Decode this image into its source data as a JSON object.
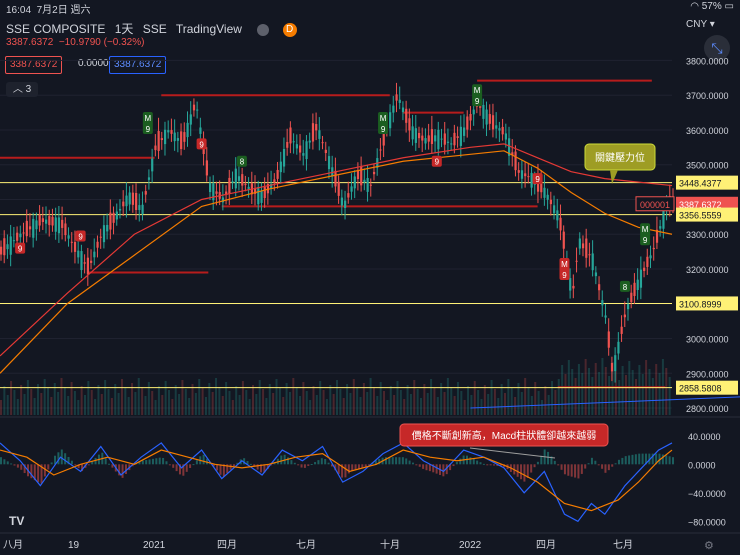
{
  "status": {
    "time": "16:04",
    "date": "7月2日 週六",
    "battery": "57%"
  },
  "header": {
    "symbol": "SSE COMPOSITE",
    "interval": "1天",
    "exchange": "SSE",
    "source": "TradingView",
    "badge": "D",
    "price": "3387.6372",
    "change": "−10.9790 (−0.32%)"
  },
  "indicators": {
    "box1": "3387.6372",
    "box2": "0.0000",
    "box3": "3387.6372",
    "collapse_count": "3"
  },
  "currency": "CNY",
  "colors": {
    "up": "#26a69a",
    "down": "#ef5350",
    "support": "#fff176",
    "resistance": "#b71c1c",
    "ma_short": "#e53935",
    "ma_long": "#f57c00",
    "macd": "#2962ff",
    "signal": "#f57c00"
  },
  "icons": {
    "expand": "expand-arrows-icon",
    "collapse": "chevron-up-icon",
    "logo": "tradingview-logo-icon",
    "settings": "gear-icon"
  },
  "chart_data": {
    "type": "candlestick",
    "price_axis": {
      "ylim": [
        2780,
        3830
      ],
      "ticks": [
        "3800.0000",
        "3700.0000",
        "3600.0000",
        "3500.0000",
        "3400.0000",
        "3300.0000",
        "3200.0000",
        "3100.0000",
        "3000.0000",
        "2900.0000",
        "2800.0000"
      ]
    },
    "macd_axis": {
      "ylim": [
        -95,
        65
      ],
      "ticks": [
        "40.0000",
        "0.0000",
        "−40.0000",
        "−80.0000"
      ]
    },
    "time_ticks": [
      {
        "label": "八月"
      },
      {
        "label": "19"
      },
      {
        "label": "2021"
      },
      {
        "label": "四月"
      },
      {
        "label": "七月"
      },
      {
        "label": "十月"
      },
      {
        "label": "2022"
      },
      {
        "label": "四月"
      },
      {
        "label": "七月"
      }
    ],
    "price_labels": [
      {
        "text": "3448.4377",
        "value": 3448.4377,
        "kind": "line"
      },
      {
        "text": "3387.6372",
        "value": 3387.6372,
        "kind": "last"
      },
      {
        "text": "3356.5559",
        "value": 3356.5559,
        "kind": "line"
      },
      {
        "text": "3100.8999",
        "value": 3100.8999,
        "kind": "line"
      },
      {
        "text": "2858.5808",
        "value": 2858.5808,
        "kind": "line"
      }
    ],
    "countdown": "000001",
    "support_lines": [
      3448.4377,
      3356.5559,
      3100.8999,
      2858.5808
    ],
    "resistance_segments": [
      {
        "from": 0,
        "to": 0.23,
        "price": 3520
      },
      {
        "from": 0.24,
        "to": 0.58,
        "price": 3700
      },
      {
        "from": 0.6,
        "to": 0.69,
        "price": 3650
      },
      {
        "from": 0.71,
        "to": 0.97,
        "price": 3742
      },
      {
        "from": 0.13,
        "to": 0.31,
        "price": 3190
      },
      {
        "from": 0.33,
        "to": 0.8,
        "price": 3380
      },
      {
        "from": 0.83,
        "to": 0.99,
        "price": 2860
      }
    ],
    "price_path": [
      [
        0,
        3250
      ],
      [
        0.03,
        3300
      ],
      [
        0.06,
        3340
      ],
      [
        0.09,
        3330
      ],
      [
        0.11,
        3260
      ],
      [
        0.13,
        3200
      ],
      [
        0.15,
        3300
      ],
      [
        0.17,
        3350
      ],
      [
        0.19,
        3410
      ],
      [
        0.21,
        3370
      ],
      [
        0.23,
        3550
      ],
      [
        0.25,
        3600
      ],
      [
        0.27,
        3560
      ],
      [
        0.29,
        3680
      ],
      [
        0.31,
        3440
      ],
      [
        0.33,
        3400
      ],
      [
        0.35,
        3470
      ],
      [
        0.37,
        3430
      ],
      [
        0.39,
        3410
      ],
      [
        0.41,
        3460
      ],
      [
        0.43,
        3580
      ],
      [
        0.45,
        3530
      ],
      [
        0.47,
        3610
      ],
      [
        0.49,
        3500
      ],
      [
        0.51,
        3380
      ],
      [
        0.53,
        3470
      ],
      [
        0.55,
        3440
      ],
      [
        0.57,
        3580
      ],
      [
        0.59,
        3700
      ],
      [
        0.61,
        3600
      ],
      [
        0.63,
        3570
      ],
      [
        0.65,
        3580
      ],
      [
        0.67,
        3560
      ],
      [
        0.69,
        3600
      ],
      [
        0.71,
        3680
      ],
      [
        0.73,
        3620
      ],
      [
        0.75,
        3590
      ],
      [
        0.77,
        3480
      ],
      [
        0.79,
        3460
      ],
      [
        0.81,
        3420
      ],
      [
        0.83,
        3350
      ],
      [
        0.84,
        3250
      ],
      [
        0.85,
        3120
      ],
      [
        0.86,
        3280
      ],
      [
        0.88,
        3230
      ],
      [
        0.9,
        3060
      ],
      [
        0.91,
        2900
      ],
      [
        0.93,
        3080
      ],
      [
        0.95,
        3170
      ],
      [
        0.97,
        3250
      ],
      [
        0.99,
        3380
      ],
      [
        1,
        3388
      ]
    ],
    "ma_short_path": [
      [
        0,
        2950
      ],
      [
        0.1,
        3130
      ],
      [
        0.2,
        3300
      ],
      [
        0.3,
        3400
      ],
      [
        0.4,
        3440
      ],
      [
        0.5,
        3480
      ],
      [
        0.6,
        3520
      ],
      [
        0.7,
        3550
      ],
      [
        0.75,
        3560
      ],
      [
        0.8,
        3520
      ],
      [
        0.85,
        3480
      ],
      [
        0.9,
        3460
      ],
      [
        1,
        3440
      ]
    ],
    "ma_long_path": [
      [
        0,
        2900
      ],
      [
        0.1,
        3100
      ],
      [
        0.2,
        3240
      ],
      [
        0.3,
        3380
      ],
      [
        0.4,
        3430
      ],
      [
        0.5,
        3470
      ],
      [
        0.6,
        3510
      ],
      [
        0.7,
        3530
      ],
      [
        0.75,
        3540
      ],
      [
        0.8,
        3490
      ],
      [
        0.85,
        3420
      ],
      [
        0.9,
        3360
      ],
      [
        0.95,
        3320
      ],
      [
        1,
        3300
      ]
    ],
    "macd_path": [
      [
        0,
        30
      ],
      [
        0.03,
        5
      ],
      [
        0.06,
        -30
      ],
      [
        0.09,
        10
      ],
      [
        0.12,
        -10
      ],
      [
        0.15,
        25
      ],
      [
        0.18,
        -15
      ],
      [
        0.21,
        10
      ],
      [
        0.24,
        30
      ],
      [
        0.27,
        -5
      ],
      [
        0.3,
        20
      ],
      [
        0.33,
        -20
      ],
      [
        0.36,
        5
      ],
      [
        0.39,
        -15
      ],
      [
        0.42,
        20
      ],
      [
        0.45,
        5
      ],
      [
        0.48,
        25
      ],
      [
        0.51,
        -25
      ],
      [
        0.54,
        -10
      ],
      [
        0.57,
        15
      ],
      [
        0.6,
        30
      ],
      [
        0.63,
        5
      ],
      [
        0.66,
        -10
      ],
      [
        0.69,
        20
      ],
      [
        0.72,
        10
      ],
      [
        0.75,
        -5
      ],
      [
        0.78,
        -40
      ],
      [
        0.81,
        -10
      ],
      [
        0.84,
        -70
      ],
      [
        0.86,
        -80
      ],
      [
        0.88,
        -55
      ],
      [
        0.9,
        -70
      ],
      [
        0.93,
        -30
      ],
      [
        0.96,
        0
      ],
      [
        0.98,
        20
      ],
      [
        1,
        30
      ]
    ],
    "signal_path": [
      [
        0,
        20
      ],
      [
        0.04,
        10
      ],
      [
        0.08,
        -15
      ],
      [
        0.12,
        0
      ],
      [
        0.16,
        10
      ],
      [
        0.2,
        0
      ],
      [
        0.24,
        20
      ],
      [
        0.28,
        10
      ],
      [
        0.32,
        0
      ],
      [
        0.36,
        -5
      ],
      [
        0.4,
        0
      ],
      [
        0.44,
        10
      ],
      [
        0.48,
        15
      ],
      [
        0.52,
        -10
      ],
      [
        0.56,
        0
      ],
      [
        0.6,
        20
      ],
      [
        0.64,
        10
      ],
      [
        0.68,
        5
      ],
      [
        0.72,
        10
      ],
      [
        0.76,
        -5
      ],
      [
        0.8,
        -25
      ],
      [
        0.84,
        -55
      ],
      [
        0.88,
        -65
      ],
      [
        0.92,
        -50
      ],
      [
        0.95,
        -25
      ],
      [
        0.98,
        5
      ],
      [
        1,
        20
      ]
    ],
    "annotations": [
      {
        "text": "關鍵壓力位",
        "kind": "callout-green"
      },
      {
        "text": "價格不斷創新高，Macd柱狀體卻越來越弱",
        "kind": "callout-red"
      }
    ],
    "markers": [
      {
        "text": "9",
        "x": 0.03,
        "price": 3260,
        "color": "down"
      },
      {
        "text": "9",
        "x": 0.12,
        "price": 3295,
        "color": "down"
      },
      {
        "text": "M\n9",
        "x": 0.22,
        "price": 3620,
        "color": "up"
      },
      {
        "text": "9",
        "x": 0.3,
        "price": 3560,
        "color": "down"
      },
      {
        "text": "8",
        "x": 0.36,
        "price": 3510,
        "color": "up"
      },
      {
        "text": "M\n9",
        "x": 0.57,
        "price": 3620,
        "color": "up"
      },
      {
        "text": "9",
        "x": 0.65,
        "price": 3510,
        "color": "down"
      },
      {
        "text": "M\n9",
        "x": 0.71,
        "price": 3700,
        "color": "up"
      },
      {
        "text": "9",
        "x": 0.8,
        "price": 3460,
        "color": "down"
      },
      {
        "text": "M\n9",
        "x": 0.84,
        "price": 3200,
        "color": "down"
      },
      {
        "text": "8",
        "x": 0.93,
        "price": 3150,
        "color": "up"
      },
      {
        "text": "M\n9",
        "x": 0.96,
        "price": 3300,
        "color": "up"
      }
    ]
  }
}
